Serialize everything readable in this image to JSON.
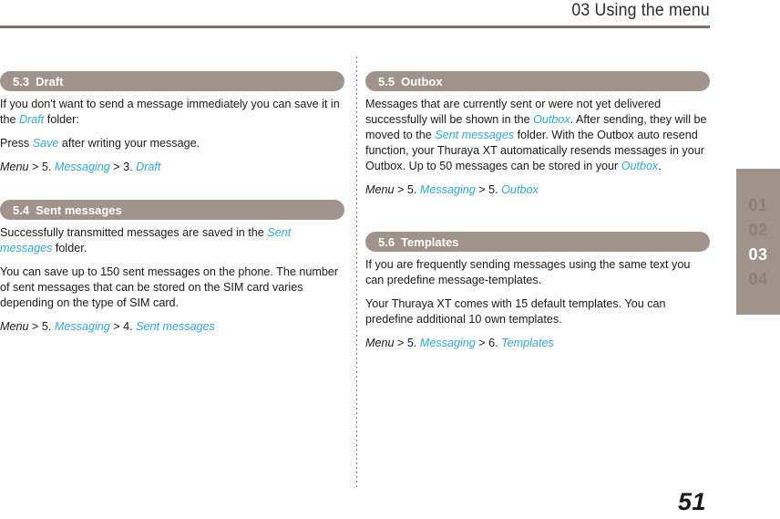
{
  "header": {
    "title": "03 Using the menu",
    "rule_color": "#7a6f6a"
  },
  "chapter_tab": {
    "items": [
      {
        "label": "01",
        "active": false
      },
      {
        "label": "02",
        "active": false
      },
      {
        "label": "03",
        "active": true
      },
      {
        "label": "04",
        "active": false
      }
    ],
    "background_color": "#a0938c",
    "active_color": "#ffffff",
    "inactive_color": "#8d7f78"
  },
  "theme": {
    "accent_color": "#29abe2",
    "bar_color": "#a0938c",
    "text_color": "#1a1a1a"
  },
  "sections": {
    "draft": {
      "number": "5.3",
      "title": "Draft",
      "p1_a": "If you don't want to send a message immediately you can save it in the ",
      "p1_accent": "Draft",
      "p1_b": " folder:",
      "p2_a": "Press ",
      "p2_accent": "Save",
      "p2_b": " after writing your message.",
      "path_menu": "Menu",
      "path_sep1": " > 5. ",
      "path_messaging": "Messaging",
      "path_sep2": " > 3. ",
      "path_last": "Draft"
    },
    "sent_messages": {
      "number": "5.4",
      "title": "Sent messages",
      "p1_a": "Successfully transmitted messages are saved in the ",
      "p1_accent": "Sent messages",
      "p1_b": " folder.",
      "p2": "You can save up to 150 sent messages on the phone. The number of sent messages that can be stored on the SIM card varies depending on the type of SIM card.",
      "path_menu": "Menu",
      "path_sep1": " > 5. ",
      "path_messaging": "Messaging",
      "path_sep2": " > 4. ",
      "path_last": "Sent messages"
    },
    "outbox": {
      "number": "5.5",
      "title": "Outbox",
      "p1_a": "Messages that are currently sent or were not yet delivered successfully will be shown in the ",
      "p1_accent1": "Outbox",
      "p1_b": ". After sending, they will be moved to the ",
      "p1_accent2": "Sent messages",
      "p1_c": " folder. With the Outbox auto resend function, your Thuraya XT automatically resends messages in your Outbox. Up to 50 messages can be stored in your ",
      "p1_accent3": "Outbox",
      "p1_d": ".",
      "path_menu": "Menu",
      "path_sep1": " > 5. ",
      "path_messaging": "Messaging",
      "path_sep2": " > 5. ",
      "path_last": "Outbox"
    },
    "templates": {
      "number": "5.6",
      "title": "Templates",
      "p1": "If you are frequently sending messages using the same text you can predefine message-templates.",
      "p2": "Your Thuraya XT comes with 15 default templates. You can predefine additional 10 own templates.",
      "path_menu": "Menu",
      "path_sep1": " > 5. ",
      "path_messaging": "Messaging",
      "path_sep2": " > 6. ",
      "path_last": "Templates"
    }
  },
  "folio": {
    "page_number": "51"
  }
}
